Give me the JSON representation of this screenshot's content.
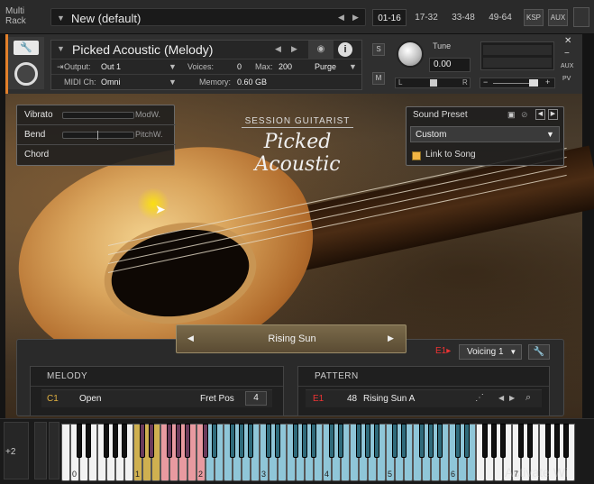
{
  "rack": {
    "label": "Multi Rack",
    "name": "New (default)",
    "pages": [
      "01-16",
      "17-32",
      "33-48",
      "49-64"
    ],
    "buttons": [
      "KSP",
      "AUX"
    ]
  },
  "instrument": {
    "title": "Picked Acoustic (Melody)",
    "output_label": "Output:",
    "output_value": "Out 1",
    "midi_label": "MIDI Ch:",
    "midi_value": "Omni",
    "voices_label": "Voices:",
    "voices_value": "0",
    "max_label": "Max:",
    "max_value": "200",
    "memory_label": "Memory:",
    "memory_value": "0.60 GB",
    "purge_label": "Purge",
    "s_label": "S",
    "m_label": "M",
    "tune_label": "Tune",
    "tune_value": "0.00",
    "pan_l": "L",
    "pan_r": "R",
    "aux_label": "AUX",
    "pv_label": "PV"
  },
  "articulations": [
    {
      "name": "Vibrato",
      "tag": "ModW."
    },
    {
      "name": "Bend",
      "tag": "PitchW."
    },
    {
      "name": "Chord",
      "tag": ""
    }
  ],
  "brand": {
    "sub": "SESSION GUITARIST",
    "main": "Picked Acoustic"
  },
  "sound_preset": {
    "title": "Sound Preset",
    "value": "Custom",
    "link_label": "Link to Song",
    "link_checked": true,
    "accent": "#f2b544"
  },
  "pattern_selector": {
    "value": "Rising Sun"
  },
  "voicing": {
    "key": "E1",
    "value": "Voicing 1"
  },
  "melody": {
    "header": "MELODY",
    "key": "C1",
    "mode": "Open",
    "fretpos_label": "Fret Pos",
    "fretpos_value": "4"
  },
  "pattern": {
    "header": "PATTERN",
    "key": "E1",
    "number": "48",
    "name": "Rising Sun A"
  },
  "keyboard": {
    "octave_shift": "+2",
    "octave_labels": [
      "0",
      "1",
      "2",
      "3",
      "4",
      "5",
      "6",
      "7"
    ]
  },
  "watermark": "Activate Wi",
  "colors": {
    "accent_orange": "#e3802a",
    "key_red": "#e33333",
    "key_blue": "#8fc6d8",
    "key_yellow": "#cfb050",
    "key_pink": "#e89aa0"
  }
}
